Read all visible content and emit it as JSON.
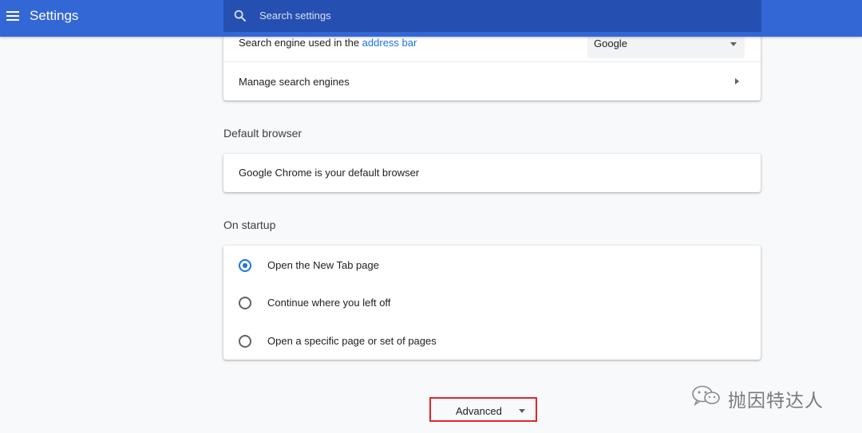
{
  "header": {
    "title": "Settings",
    "search_placeholder": "Search settings"
  },
  "search_engine": {
    "label_prefix": "Search engine used in the ",
    "label_link": "address bar",
    "selected": "Google",
    "manage_label": "Manage search engines"
  },
  "default_browser": {
    "section_title": "Default browser",
    "status": "Google Chrome is your default browser"
  },
  "startup": {
    "section_title": "On startup",
    "options": [
      {
        "label": "Open the New Tab page",
        "checked": true
      },
      {
        "label": "Continue where you left off",
        "checked": false
      },
      {
        "label": "Open a specific page or set of pages",
        "checked": false
      }
    ]
  },
  "advanced": {
    "label": "Advanced"
  },
  "watermark": {
    "text": "抛因特达人",
    "icon": "wechat-icon"
  },
  "colors": {
    "header": "#3367d6",
    "search_box": "#254fb0",
    "accent": "#1a73e8",
    "highlight_border": "#e0262c"
  }
}
